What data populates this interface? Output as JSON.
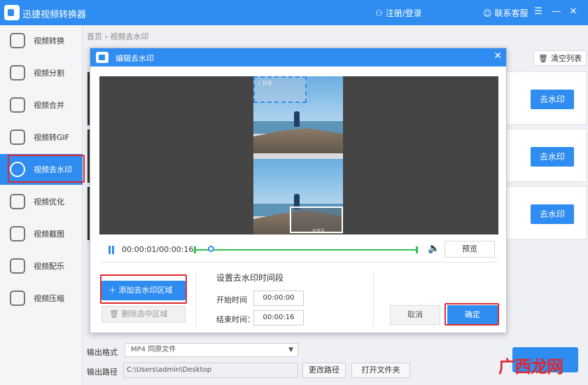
{
  "app": {
    "title": "迅捷视频转换器",
    "login": "注册/登录",
    "service": "联系客服"
  },
  "sidebar": {
    "items": [
      {
        "label": "视频转换"
      },
      {
        "label": "视频分割"
      },
      {
        "label": "视频合并"
      },
      {
        "label": "视频转GIF"
      },
      {
        "label": "视频去水印",
        "active": true
      },
      {
        "label": "视频优化"
      },
      {
        "label": "视频截图"
      },
      {
        "label": "视频配乐"
      },
      {
        "label": "视频压缩"
      }
    ]
  },
  "main": {
    "breadcrumb": {
      "home": "首页",
      "separator": "›",
      "current": "视频去水印"
    },
    "clear_list": "清空列表",
    "rows": [
      {
        "button": "去水印"
      },
      {
        "button": "去水印"
      },
      {
        "button": "去水印"
      }
    ],
    "output": {
      "format_label": "输出格式",
      "format_value": "MP4  同原文件",
      "path_label": "输出路径",
      "path_value": "C:\\Users\\admin\\Desktop",
      "change_path": "更改路径",
      "open_folder": "打开文件夹"
    }
  },
  "dialog": {
    "title": "编辑去水印",
    "video": {
      "watermark_text_top": "♪ 抖音",
      "watermark_text_bottom": "抖音号"
    },
    "player": {
      "current_time": "00:00:01",
      "total_time": "00:00:16",
      "time_display": "00:00:01/00:00:16",
      "progress": 0.06,
      "preview": "预览"
    },
    "add_area": "添加去水印区域",
    "delete_area": "删除选中区域",
    "segment": {
      "title": "设置去水印时间段",
      "start_label": "开始时间",
      "start_value": "00:00:00",
      "end_label": "结束时间：",
      "end_value": "00:00:16"
    },
    "cancel": "取消",
    "confirm": "确定"
  },
  "watermark_logo": "广西龙网",
  "colors": {
    "accent": "#2f8cf0",
    "highlight": "#e0282e",
    "track": "#2ec24a"
  }
}
